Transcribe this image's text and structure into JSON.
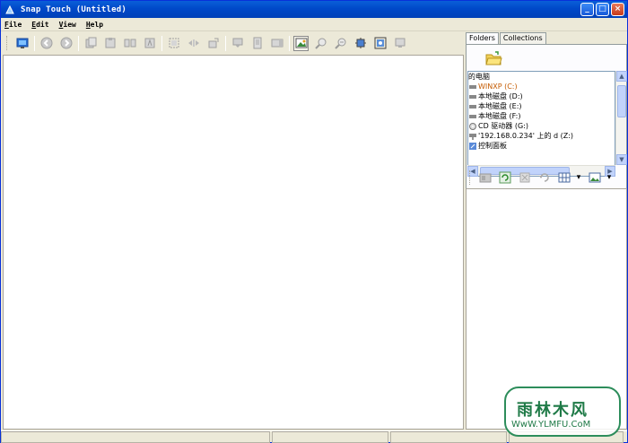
{
  "window": {
    "title": "Snap Touch (Untitled)",
    "controls": {
      "minimize": "_",
      "maximize": "□",
      "close": "×"
    }
  },
  "menu": [
    {
      "label": "File",
      "accel": "F"
    },
    {
      "label": "Edit",
      "accel": "E"
    },
    {
      "label": "View",
      "accel": "V"
    },
    {
      "label": "Help",
      "accel": "H"
    }
  ],
  "toolbar": {
    "icons": [
      "capture-icon",
      "back-icon",
      "forward-icon",
      "grayed-tool-icons",
      "image-view-icon",
      "zoom-in-icon",
      "zoom-out-icon",
      "fit-icon",
      "screen-capture-icon",
      "monitor-icon"
    ]
  },
  "side_panel": {
    "tabs": [
      {
        "label": "Folders",
        "active": true
      },
      {
        "label": "Collections",
        "active": false
      }
    ],
    "tree": [
      {
        "label": "的电脑",
        "icon": "computer-icon",
        "selected": false
      },
      {
        "label": "WINXP (C:)",
        "icon": "drive-icon",
        "selected": true
      },
      {
        "label": "本地磁盘 (D:)",
        "icon": "drive-icon",
        "selected": false
      },
      {
        "label": "本地磁盘 (E:)",
        "icon": "drive-icon",
        "selected": false
      },
      {
        "label": "本地磁盘 (F:)",
        "icon": "drive-icon",
        "selected": false
      },
      {
        "label": "CD 驱动器 (G:)",
        "icon": "cd-drive-icon",
        "selected": false
      },
      {
        "label": "'192.168.0.234' 上的 d (Z:)",
        "icon": "network-drive-icon",
        "selected": false
      },
      {
        "label": "控制面板",
        "icon": "control-panel-icon",
        "selected": false
      }
    ]
  },
  "watermark": {
    "main": "雨林木风",
    "sub": "WwW.YLMFU.CoM"
  },
  "colors": {
    "titlebar": "#0049c9",
    "chrome": "#ece9d8",
    "close_button": "#c63a1a",
    "selected_tree_text": "#c45a00",
    "watermark": "#1f7a47"
  }
}
